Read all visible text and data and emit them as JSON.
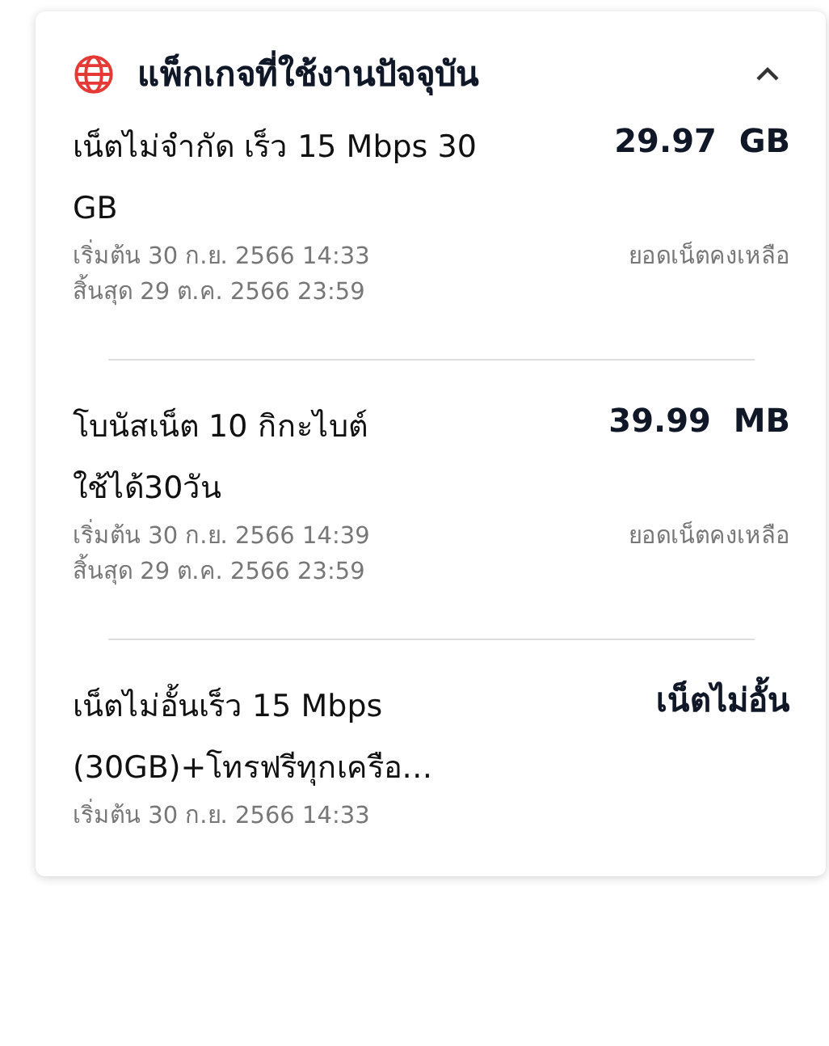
{
  "section": {
    "title": "แพ็กเกจที่ใช้งานปัจจุบัน",
    "expanded": true
  },
  "packages": [
    {
      "name_lines": [
        "เน็ตไม่จำกัด เร็ว 15 Mbps 30",
        "GB"
      ],
      "amount": "29.97  GB",
      "dates": [
        "เริ่มต้น 30 ก.ย. 2566 14:33",
        "สิ้นสุด 29 ต.ค. 2566 23:59"
      ],
      "remaining_label": "ยอดเน็ตคงเหลือ"
    },
    {
      "name_lines": [
        "โบนัสเน็ต 10 กิกะไบต์",
        "ใช้ได้30วัน"
      ],
      "amount": "39.99  MB",
      "dates": [
        "เริ่มต้น 30 ก.ย. 2566 14:39",
        "สิ้นสุด 29 ต.ค. 2566 23:59"
      ],
      "remaining_label": "ยอดเน็ตคงเหลือ"
    },
    {
      "name_lines": [
        "เน็ตไม่อั้นเร็ว 15 Mbps",
        "(30GB)+โทรฟรีทุกเครือ…"
      ],
      "amount": "เน็ตไม่อั้น",
      "dates": [
        "เริ่มต้น 30 ก.ย. 2566 14:33"
      ]
    }
  ]
}
